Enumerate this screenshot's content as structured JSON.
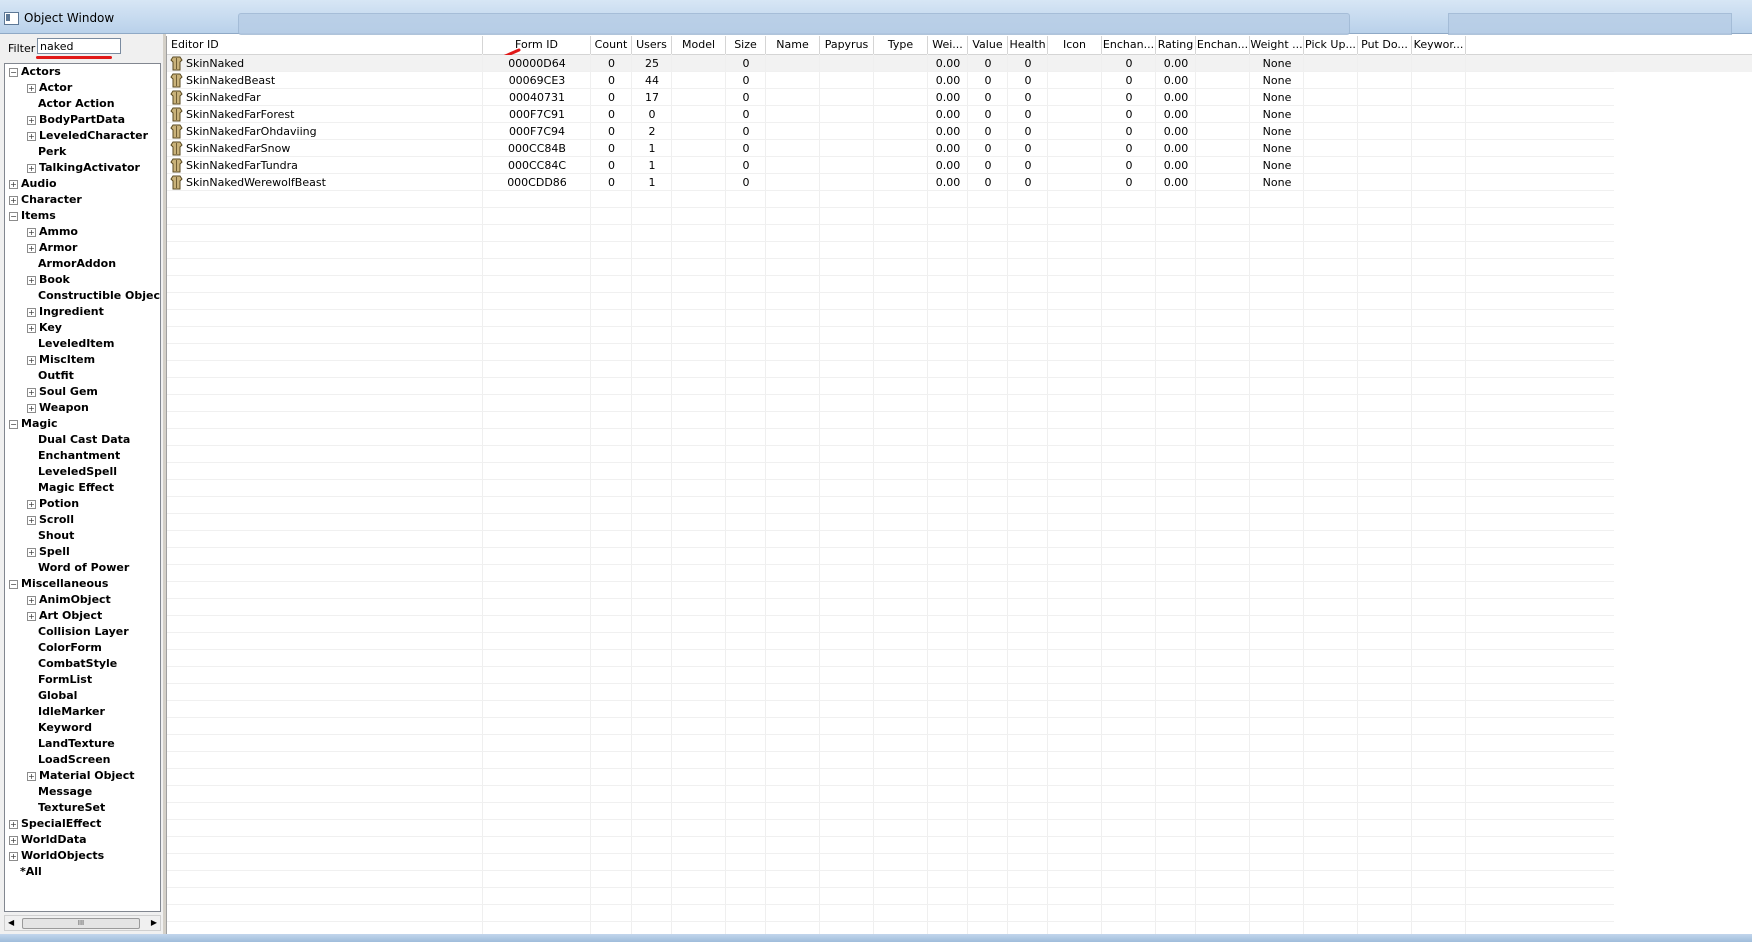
{
  "window": {
    "title": "Object Window"
  },
  "filter": {
    "label": "Filter",
    "value": "naked"
  },
  "tree": [
    {
      "label": "Actors",
      "level": 0,
      "exp": "-"
    },
    {
      "label": "Actor",
      "level": 1,
      "exp": "+"
    },
    {
      "label": "Actor Action",
      "level": 1,
      "exp": ""
    },
    {
      "label": "BodyPartData",
      "level": 1,
      "exp": "+"
    },
    {
      "label": "LeveledCharacter",
      "level": 1,
      "exp": "+"
    },
    {
      "label": "Perk",
      "level": 1,
      "exp": ""
    },
    {
      "label": "TalkingActivator",
      "level": 1,
      "exp": "+"
    },
    {
      "label": "Audio",
      "level": 0,
      "exp": "+"
    },
    {
      "label": "Character",
      "level": 0,
      "exp": "+"
    },
    {
      "label": "Items",
      "level": 0,
      "exp": "-"
    },
    {
      "label": "Ammo",
      "level": 1,
      "exp": "+"
    },
    {
      "label": "Armor",
      "level": 1,
      "exp": "+"
    },
    {
      "label": "ArmorAddon",
      "level": 1,
      "exp": ""
    },
    {
      "label": "Book",
      "level": 1,
      "exp": "+"
    },
    {
      "label": "Constructible Objec",
      "level": 1,
      "exp": ""
    },
    {
      "label": "Ingredient",
      "level": 1,
      "exp": "+"
    },
    {
      "label": "Key",
      "level": 1,
      "exp": "+"
    },
    {
      "label": "LeveledItem",
      "level": 1,
      "exp": ""
    },
    {
      "label": "MiscItem",
      "level": 1,
      "exp": "+"
    },
    {
      "label": "Outfit",
      "level": 1,
      "exp": ""
    },
    {
      "label": "Soul Gem",
      "level": 1,
      "exp": "+"
    },
    {
      "label": "Weapon",
      "level": 1,
      "exp": "+"
    },
    {
      "label": "Magic",
      "level": 0,
      "exp": "-"
    },
    {
      "label": "Dual Cast Data",
      "level": 1,
      "exp": ""
    },
    {
      "label": "Enchantment",
      "level": 1,
      "exp": ""
    },
    {
      "label": "LeveledSpell",
      "level": 1,
      "exp": ""
    },
    {
      "label": "Magic Effect",
      "level": 1,
      "exp": ""
    },
    {
      "label": "Potion",
      "level": 1,
      "exp": "+"
    },
    {
      "label": "Scroll",
      "level": 1,
      "exp": "+"
    },
    {
      "label": "Shout",
      "level": 1,
      "exp": ""
    },
    {
      "label": "Spell",
      "level": 1,
      "exp": "+"
    },
    {
      "label": "Word of Power",
      "level": 1,
      "exp": ""
    },
    {
      "label": "Miscellaneous",
      "level": 0,
      "exp": "-"
    },
    {
      "label": "AnimObject",
      "level": 1,
      "exp": "+"
    },
    {
      "label": "Art Object",
      "level": 1,
      "exp": "+"
    },
    {
      "label": "Collision Layer",
      "level": 1,
      "exp": ""
    },
    {
      "label": "ColorForm",
      "level": 1,
      "exp": ""
    },
    {
      "label": "CombatStyle",
      "level": 1,
      "exp": ""
    },
    {
      "label": "FormList",
      "level": 1,
      "exp": ""
    },
    {
      "label": "Global",
      "level": 1,
      "exp": ""
    },
    {
      "label": "IdleMarker",
      "level": 1,
      "exp": ""
    },
    {
      "label": "Keyword",
      "level": 1,
      "exp": ""
    },
    {
      "label": "LandTexture",
      "level": 1,
      "exp": ""
    },
    {
      "label": "LoadScreen",
      "level": 1,
      "exp": ""
    },
    {
      "label": "Material Object",
      "level": 1,
      "exp": "+"
    },
    {
      "label": "Message",
      "level": 1,
      "exp": ""
    },
    {
      "label": "TextureSet",
      "level": 1,
      "exp": ""
    },
    {
      "label": "SpecialEffect",
      "level": 0,
      "exp": "+"
    },
    {
      "label": "WorldData",
      "level": 0,
      "exp": "+"
    },
    {
      "label": "WorldObjects",
      "level": 0,
      "exp": "+"
    },
    {
      "label": "*All",
      "level": 0,
      "exp": ""
    }
  ],
  "columns": [
    "Editor ID",
    "Form ID",
    "Count",
    "Users",
    "Model",
    "Size",
    "Name",
    "Papyrus",
    "Type",
    "Wei...",
    "Value",
    "Health",
    "Icon",
    "Enchan...",
    "Rating",
    "Enchan...",
    "Weight ...",
    "Pick Up...",
    "Put Do...",
    "Keywor..."
  ],
  "rows": [
    {
      "editor_id": "SkinNaked",
      "form_id": "00000D64",
      "count": "0",
      "users": "25",
      "size": "0",
      "weight": "0.00",
      "value": "0",
      "health": "0",
      "enchant": "0",
      "rating": "0.00",
      "weight_class": "None"
    },
    {
      "editor_id": "SkinNakedBeast",
      "form_id": "00069CE3",
      "count": "0",
      "users": "44",
      "size": "0",
      "weight": "0.00",
      "value": "0",
      "health": "0",
      "enchant": "0",
      "rating": "0.00",
      "weight_class": "None"
    },
    {
      "editor_id": "SkinNakedFar",
      "form_id": "00040731",
      "count": "0",
      "users": "17",
      "size": "0",
      "weight": "0.00",
      "value": "0",
      "health": "0",
      "enchant": "0",
      "rating": "0.00",
      "weight_class": "None"
    },
    {
      "editor_id": "SkinNakedFarForest",
      "form_id": "000F7C91",
      "count": "0",
      "users": "0",
      "size": "0",
      "weight": "0.00",
      "value": "0",
      "health": "0",
      "enchant": "0",
      "rating": "0.00",
      "weight_class": "None"
    },
    {
      "editor_id": "SkinNakedFarOhdaviing",
      "form_id": "000F7C94",
      "count": "0",
      "users": "2",
      "size": "0",
      "weight": "0.00",
      "value": "0",
      "health": "0",
      "enchant": "0",
      "rating": "0.00",
      "weight_class": "None"
    },
    {
      "editor_id": "SkinNakedFarSnow",
      "form_id": "000CC84B",
      "count": "0",
      "users": "1",
      "size": "0",
      "weight": "0.00",
      "value": "0",
      "health": "0",
      "enchant": "0",
      "rating": "0.00",
      "weight_class": "None"
    },
    {
      "editor_id": "SkinNakedFarTundra",
      "form_id": "000CC84C",
      "count": "0",
      "users": "1",
      "size": "0",
      "weight": "0.00",
      "value": "0",
      "health": "0",
      "enchant": "0",
      "rating": "0.00",
      "weight_class": "None"
    },
    {
      "editor_id": "SkinNakedWerewolfBeast",
      "form_id": "000CDD86",
      "count": "0",
      "users": "1",
      "size": "0",
      "weight": "0.00",
      "value": "0",
      "health": "0",
      "enchant": "0",
      "rating": "0.00",
      "weight_class": "None"
    }
  ],
  "colors": {
    "annotation_red": "#e01818",
    "titlebar": "#b9d1ea"
  },
  "icons": {
    "row_icon": "armor-icon",
    "annotation": "red-arrow-icon"
  }
}
